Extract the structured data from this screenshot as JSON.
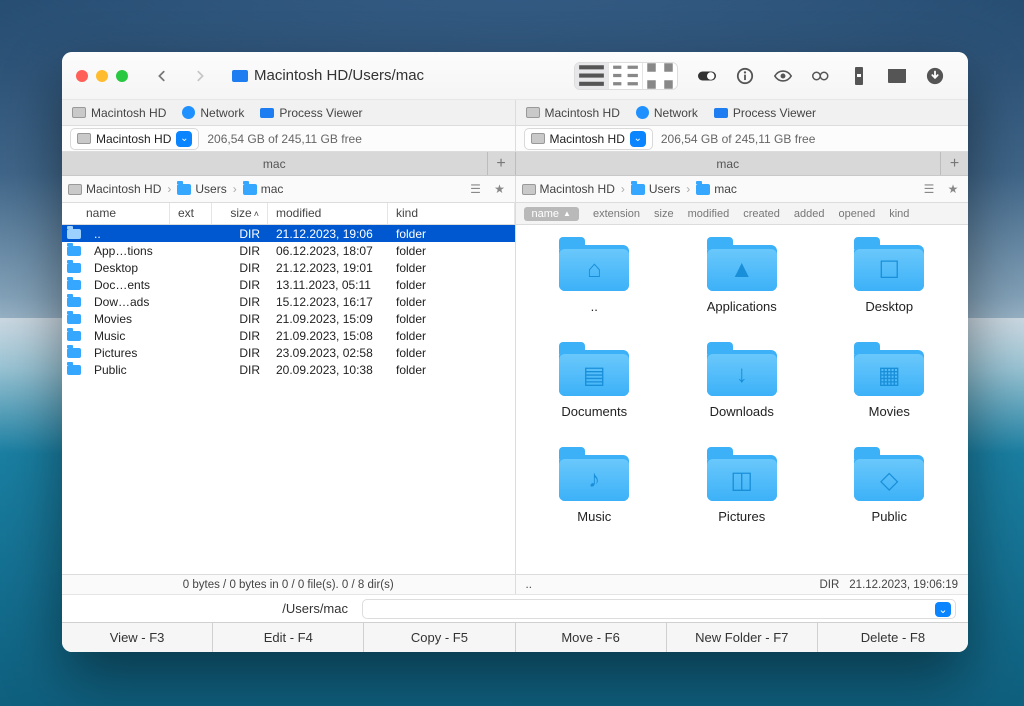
{
  "window": {
    "title": "Macintosh HD/Users/mac"
  },
  "favorites": {
    "left": [
      {
        "label": "Macintosh HD",
        "icon": "hd"
      },
      {
        "label": "Network",
        "icon": "globe"
      },
      {
        "label": "Process Viewer",
        "icon": "screen"
      }
    ],
    "right": [
      {
        "label": "Macintosh HD",
        "icon": "hd"
      },
      {
        "label": "Network",
        "icon": "globe"
      },
      {
        "label": "Process Viewer",
        "icon": "screen"
      }
    ]
  },
  "disk": {
    "left": {
      "name": "Macintosh HD",
      "free": "206,54 GB of 245,11 GB free"
    },
    "right": {
      "name": "Macintosh HD",
      "free": "206,54 GB of 245,11 GB free"
    }
  },
  "tabs": {
    "left": "mac",
    "right": "mac"
  },
  "breadcrumb": {
    "left": [
      {
        "label": "Macintosh HD",
        "icon": "hd"
      },
      {
        "label": "Users",
        "icon": "folder"
      },
      {
        "label": "mac",
        "icon": "folder"
      }
    ],
    "right": [
      {
        "label": "Macintosh HD",
        "icon": "hd"
      },
      {
        "label": "Users",
        "icon": "folder"
      },
      {
        "label": "mac",
        "icon": "folder"
      }
    ]
  },
  "listHeaders": {
    "name": "name",
    "ext": "ext",
    "size": "size",
    "modified": "modified",
    "kind": "kind"
  },
  "iconHeaders": {
    "name": "name",
    "extension": "extension",
    "size": "size",
    "modified": "modified",
    "created": "created",
    "added": "added",
    "opened": "opened",
    "kind": "kind"
  },
  "leftRows": [
    {
      "name": "..",
      "size": "DIR",
      "modified": "21.12.2023, 19:06",
      "kind": "folder",
      "sel": true
    },
    {
      "name": "App…tions",
      "size": "DIR",
      "modified": "06.12.2023, 18:07",
      "kind": "folder"
    },
    {
      "name": "Desktop",
      "size": "DIR",
      "modified": "21.12.2023, 19:01",
      "kind": "folder"
    },
    {
      "name": "Doc…ents",
      "size": "DIR",
      "modified": "13.11.2023, 05:11",
      "kind": "folder"
    },
    {
      "name": "Dow…ads",
      "size": "DIR",
      "modified": "15.12.2023, 16:17",
      "kind": "folder"
    },
    {
      "name": "Movies",
      "size": "DIR",
      "modified": "21.09.2023, 15:09",
      "kind": "folder"
    },
    {
      "name": "Music",
      "size": "DIR",
      "modified": "21.09.2023, 15:08",
      "kind": "folder"
    },
    {
      "name": "Pictures",
      "size": "DIR",
      "modified": "23.09.2023, 02:58",
      "kind": "folder"
    },
    {
      "name": "Public",
      "size": "DIR",
      "modified": "20.09.2023, 10:38",
      "kind": "folder"
    }
  ],
  "rightIcons": [
    {
      "label": "..",
      "glyph": "home"
    },
    {
      "label": "Applications",
      "glyph": "app"
    },
    {
      "label": "Desktop",
      "glyph": "desktop"
    },
    {
      "label": "Documents",
      "glyph": "doc"
    },
    {
      "label": "Downloads",
      "glyph": "down"
    },
    {
      "label": "Movies",
      "glyph": "movie"
    },
    {
      "label": "Music",
      "glyph": "music"
    },
    {
      "label": "Pictures",
      "glyph": "pic"
    },
    {
      "label": "Public",
      "glyph": "public"
    }
  ],
  "status": {
    "left": "0 bytes / 0 bytes in 0 / 0 file(s). 0 / 8 dir(s)",
    "right_dots": "..",
    "right_dir": "DIR",
    "right_ts": "21.12.2023, 19:06:19"
  },
  "cmd": {
    "path": "/Users/mac"
  },
  "fkeys": [
    "View - F3",
    "Edit - F4",
    "Copy - F5",
    "Move - F6",
    "New Folder - F7",
    "Delete - F8"
  ]
}
